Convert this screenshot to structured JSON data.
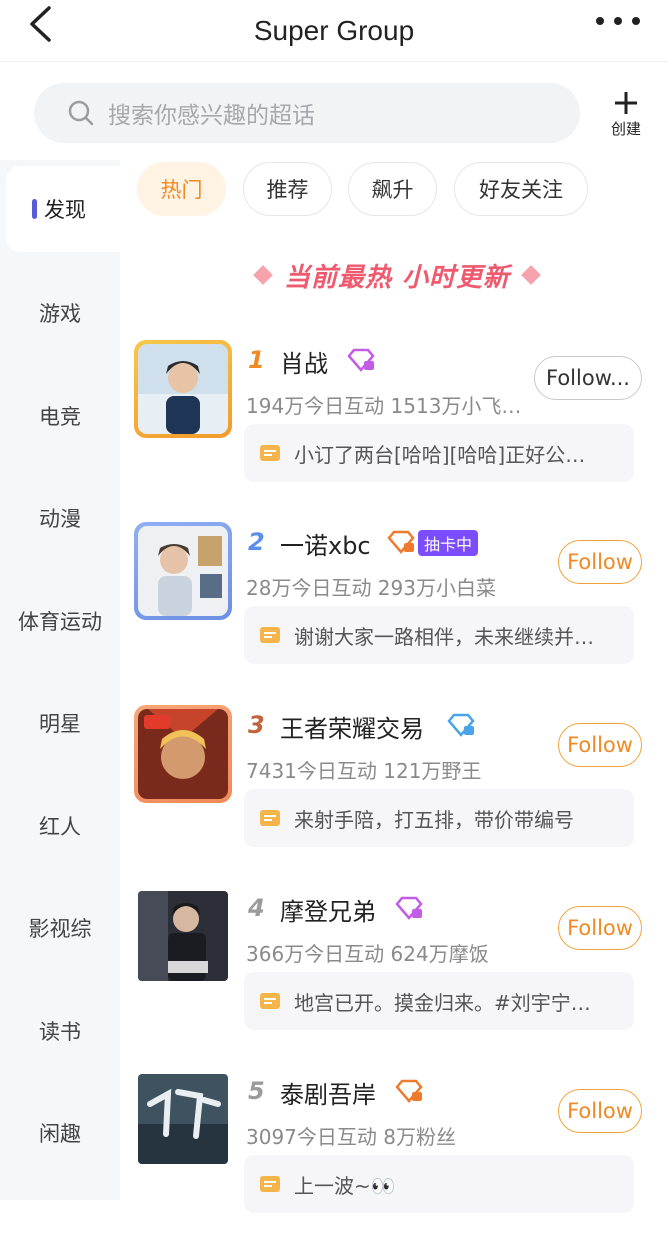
{
  "header": {
    "title": "Super Group"
  },
  "search": {
    "placeholder": "搜索你感兴趣的超话"
  },
  "create": {
    "label": "创建"
  },
  "sidebar": {
    "items": [
      {
        "label": "发现",
        "active": true
      },
      {
        "label": "游戏"
      },
      {
        "label": "电竞"
      },
      {
        "label": "动漫"
      },
      {
        "label": "体育运动"
      },
      {
        "label": "明星"
      },
      {
        "label": "红人"
      },
      {
        "label": "影视综"
      },
      {
        "label": "读书"
      },
      {
        "label": "闲趣"
      }
    ]
  },
  "chips": [
    {
      "label": "热门",
      "active": true
    },
    {
      "label": "推荐"
    },
    {
      "label": "飙升"
    },
    {
      "label": "好友关注"
    }
  ],
  "banner": {
    "text": "当前最热 小时更新"
  },
  "items": [
    {
      "rank": "1",
      "name": "肖战",
      "stats": "194万今日互动 1513万小飞…",
      "post": "小订了两台[哈哈][哈哈]正好公…",
      "follow": "Follow...",
      "rank_color": "#f08a24",
      "gem_color": "#c25be6"
    },
    {
      "rank": "2",
      "name": "一诺xbc",
      "badge": "抽卡中",
      "stats": "28万今日互动 293万小白菜",
      "post": "谢谢大家一路相伴，未来继续并…",
      "follow": "Follow",
      "rank_color": "#5a8dee",
      "gem_color": "#ee7a2d"
    },
    {
      "rank": "3",
      "name": "王者荣耀交易",
      "stats": "7431今日互动 121万野王",
      "post": "来射手陪，打五排，带价带编号",
      "follow": "Follow",
      "rank_color": "#c0643a",
      "gem_color": "#4aa3e6"
    },
    {
      "rank": "4",
      "name": "摩登兄弟",
      "stats": "366万今日互动 624万摩饭",
      "post": "地宫已开。摸金归来。#刘宇宁…",
      "follow": "Follow",
      "rank_color": "#9b9b9b",
      "gem_color": "#c25be6"
    },
    {
      "rank": "5",
      "name": "泰剧吾岸",
      "stats": "3097今日互动 8万粉丝",
      "post": "上一波~👀",
      "follow": "Follow",
      "rank_color": "#9b9b9b",
      "gem_color": "#ee7a2d"
    }
  ]
}
